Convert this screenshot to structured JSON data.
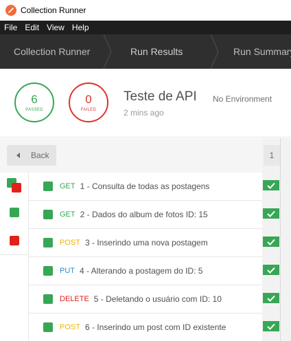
{
  "window": {
    "title": "Collection Runner"
  },
  "menu": [
    "File",
    "Edit",
    "View",
    "Help"
  ],
  "tabs": [
    {
      "label": "Collection Runner"
    },
    {
      "label": "Run Results"
    },
    {
      "label": "Run Summary"
    }
  ],
  "summary": {
    "passed_count": "6",
    "passed_label": "PASSED",
    "failed_count": "0",
    "failed_label": "FAILED",
    "run_name": "Teste de API",
    "environment": "No Environment",
    "time_ago": "2 mins ago"
  },
  "back_label": "Back",
  "iteration_label": "1",
  "colors": {
    "pass": "#37a756",
    "fail": "#e0221b",
    "post": "#f0b400",
    "put": "#2a8bd0",
    "header": "#2f2f2f"
  },
  "requests": [
    {
      "method": "GET",
      "name": "1 - Consulta de todas as postagens",
      "status": "pass"
    },
    {
      "method": "GET",
      "name": "2 - Dados do album de fotos ID: 15",
      "status": "pass"
    },
    {
      "method": "POST",
      "name": "3 - Inserindo uma nova postagem",
      "status": "pass"
    },
    {
      "method": "PUT",
      "name": "4 - Alterando a postagem do ID: 5",
      "status": "pass"
    },
    {
      "method": "DELETE",
      "name": "5 - Deletando o usuário com ID: 10",
      "status": "pass"
    },
    {
      "method": "POST",
      "name": "6 - Inserindo um post com ID existente",
      "status": "pass"
    }
  ]
}
